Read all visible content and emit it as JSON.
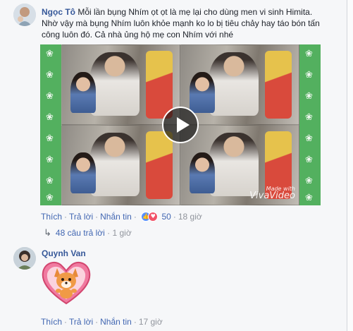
{
  "comments": [
    {
      "author": "Ngọc Tô",
      "text": "Mỗi lần bụng Nhím ọt ọt là mẹ lại cho dùng men vi sinh Himita. Nhờ vậy mà bụng Nhím luôn khỏe mạnh ko lo bị tiêu chảy hay táo bón tấn công luôn đó. Cả nhà ủng hộ mẹ con Nhím với nhé",
      "video": {
        "watermark_small": "Made with",
        "watermark": "VivaVideo"
      },
      "actions": {
        "like": "Thích",
        "reply": "Trả lời",
        "message": "Nhắn tin",
        "reaction_count": "50",
        "time": "18 giờ"
      },
      "replies": {
        "label": "48 câu trả lời",
        "time": "1 giờ"
      }
    },
    {
      "author": "Quynh Van",
      "sticker": "fox-love-heart-sticker",
      "actions": {
        "like": "Thích",
        "reply": "Trả lời",
        "message": "Nhắn tin",
        "time": "17 giờ"
      }
    }
  ],
  "colors": {
    "link": "#4267b2",
    "name": "#365899",
    "muted": "#90949c",
    "video_border": "#5fb86a"
  },
  "icons": [
    "like-reaction-icon",
    "love-reaction-icon",
    "reply-arrow-icon",
    "play-icon",
    "paw-print-icon"
  ]
}
